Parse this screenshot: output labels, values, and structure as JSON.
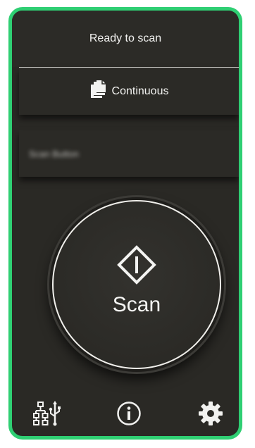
{
  "status": {
    "text": "Ready to scan"
  },
  "mode": {
    "icon": "copy-pages-icon",
    "label": "Continuous"
  },
  "profile": {
    "label": "Scan Button"
  },
  "scan_button": {
    "icon": "diamond-start-icon",
    "label": "Scan"
  },
  "footer": {
    "connection_icon": "network-usb-icon",
    "info_icon": "info-icon",
    "settings_icon": "gear-icon"
  },
  "colors": {
    "frame": "#2fcf73",
    "panel": "#2a2925",
    "text": "#f2f2f0"
  }
}
